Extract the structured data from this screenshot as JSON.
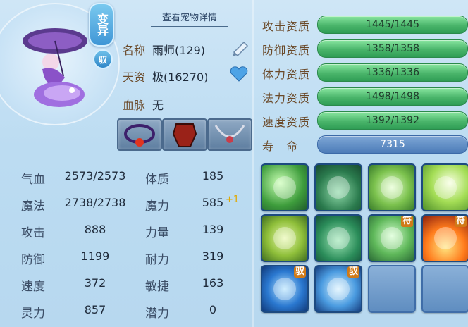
{
  "header": {
    "view_details": "查看宠物详情",
    "badge_transform": "变异",
    "badge_rider": "驭"
  },
  "info": {
    "name_label": "名称",
    "name_value": "雨师(129)",
    "talent_label": "天资",
    "talent_value": "极(16270)",
    "blood_label": "血脉",
    "blood_value": "无"
  },
  "attributes": [
    {
      "label": "气血",
      "value": "2573/2573"
    },
    {
      "label": "魔法",
      "value": "2738/2738"
    },
    {
      "label": "攻击",
      "value": "888"
    },
    {
      "label": "防御",
      "value": "1199"
    },
    {
      "label": "速度",
      "value": "372"
    },
    {
      "label": "灵力",
      "value": "857"
    }
  ],
  "points": [
    {
      "label": "体质",
      "value": "185",
      "bonus": ""
    },
    {
      "label": "魔力",
      "value": "585",
      "bonus": "+1"
    },
    {
      "label": "力量",
      "value": "139",
      "bonus": ""
    },
    {
      "label": "耐力",
      "value": "319",
      "bonus": ""
    },
    {
      "label": "敏捷",
      "value": "163",
      "bonus": ""
    },
    {
      "label": "潜力",
      "value": "0",
      "bonus": ""
    }
  ],
  "aptitudes": [
    {
      "label": "攻击资质",
      "value": "1445/1445",
      "fill": 1.0
    },
    {
      "label": "防御资质",
      "value": "1358/1358",
      "fill": 1.0
    },
    {
      "label": "体力资质",
      "value": "1336/1336",
      "fill": 1.0
    },
    {
      "label": "法力资质",
      "value": "1498/1498",
      "fill": 1.0
    },
    {
      "label": "速度资质",
      "value": "1392/1392",
      "fill": 1.0
    },
    {
      "label": "寿　命",
      "value": "7315"
    }
  ],
  "skills": [
    {
      "icon": "ghost-cry-icon",
      "tag": ""
    },
    {
      "icon": "body-shadow-icon",
      "tag": ""
    },
    {
      "icon": "hand-seal-icon",
      "tag": ""
    },
    {
      "icon": "palm-light-icon",
      "tag": ""
    },
    {
      "icon": "shield-banner-icon",
      "tag": ""
    },
    {
      "icon": "green-serpent-icon",
      "tag": ""
    },
    {
      "icon": "ghost-charm-icon",
      "tag": "符"
    },
    {
      "icon": "fire-charm-icon",
      "tag": "符"
    },
    {
      "icon": "blue-shield-icon",
      "tag": "驭"
    },
    {
      "icon": "blue-slash-icon",
      "tag": "驭"
    },
    {
      "icon": "empty-slot",
      "tag": ""
    },
    {
      "icon": "empty-slot",
      "tag": ""
    }
  ],
  "colors": {
    "aptitude_bar": "#4ab56b",
    "life_bar": "#4d7cb8",
    "bonus": "#e0a800"
  }
}
